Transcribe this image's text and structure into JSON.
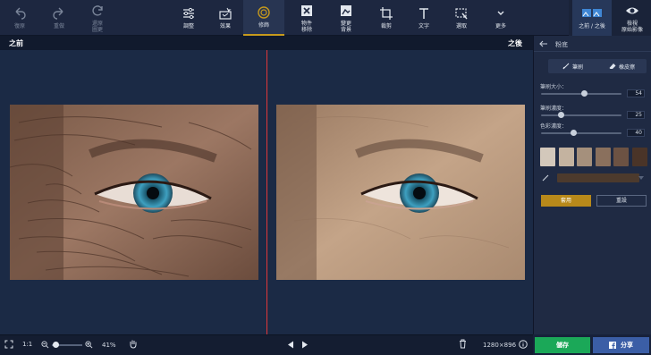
{
  "toolbar": {
    "undo": "復原",
    "redo": "重做",
    "revert": "還原\n圖更",
    "adjust": "調整",
    "effects": "效果",
    "retouch": "修飾",
    "object_removal": "物件\n移除",
    "change_bg": "變更\n背景",
    "crop": "裁剪",
    "text": "文字",
    "select": "選取",
    "more": "更多",
    "before_after": "之前 / 之後",
    "view_original": "檢視\n原始影像"
  },
  "compare": {
    "before_label": "之前",
    "after_label": "之後"
  },
  "bottom": {
    "fit_label": "1:1",
    "zoom": "41%",
    "dimensions": "1280×896"
  },
  "panel": {
    "title": "粉底",
    "brush_label": "筆刷",
    "eraser_label": "橡皮擦",
    "brush_size_label": "筆刷大小：",
    "brush_size_value": "54",
    "brush_size_level": 0.54,
    "brush_opacity_label": "筆刷濃度：",
    "brush_opacity_value": "25",
    "brush_opacity_level": 0.25,
    "color_opacity_label": "色彩濃度：",
    "color_opacity_value": "40",
    "color_opacity_level": 0.4,
    "swatches": [
      "#d3c8bb",
      "#c4b3a0",
      "#a5907c",
      "#8a705d",
      "#6c5243",
      "#4a3428"
    ],
    "apply_label": "套用",
    "reset_label": "重設"
  },
  "actions": {
    "save_label": "儲存",
    "share_label": "分享"
  },
  "colors": {
    "accent": "#c79a1c",
    "divider": "#e0373a",
    "save": "#1ba858",
    "share": "#3b5ea6"
  }
}
